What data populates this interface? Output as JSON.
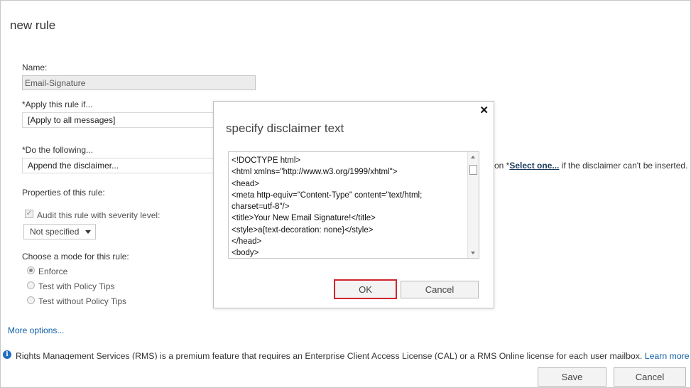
{
  "page": {
    "title": "new rule"
  },
  "form": {
    "name_label": "Name:",
    "name_value": "Email-Signature",
    "apply_label": "*Apply this rule if...",
    "apply_value": "[Apply to all messages]",
    "do_label": "*Do the following...",
    "do_value": "Append the disclaimer...",
    "fallback_prefix": "on *",
    "fallback_link": "Select one...",
    "fallback_suffix": " if the disclaimer can't be inserted.",
    "properties_label": "Properties of this rule:",
    "audit_label": "Audit this rule with severity level:",
    "audit_checked": true,
    "severity_value": "Not specified",
    "mode_label": "Choose a mode for this rule:",
    "modes": [
      {
        "label": "Enforce",
        "selected": true
      },
      {
        "label": "Test with Policy Tips",
        "selected": false
      },
      {
        "label": "Test without Policy Tips",
        "selected": false
      }
    ],
    "more_options": "More options..."
  },
  "notice": {
    "text": "Rights Management Services (RMS) is a premium feature that requires an Enterprise Client Access License (CAL) or a RMS Online license for each user mailbox.",
    "link": "Learn more"
  },
  "footer": {
    "save": "Save",
    "cancel": "Cancel"
  },
  "dialog": {
    "title": "specify disclaimer text",
    "close_icon": "close-icon",
    "lines": [
      "<!DOCTYPE html>",
      "<html xmlns=\"http://www.w3.org/1999/xhtml\">",
      "  <head>",
      "    <meta http-equiv=\"Content-Type\" content=\"text/html;",
      "charset=utf-8\"/>",
      "    <title>Your New Email Signature!</title>",
      "    <style>a{text-decoration: none}</style>",
      "  </head>",
      "  <body>"
    ],
    "ok": "OK",
    "cancel": "Cancel"
  },
  "colors": {
    "link": "#0e5ea8",
    "highlight": "#d0252e",
    "info": "#1e6fc0"
  }
}
